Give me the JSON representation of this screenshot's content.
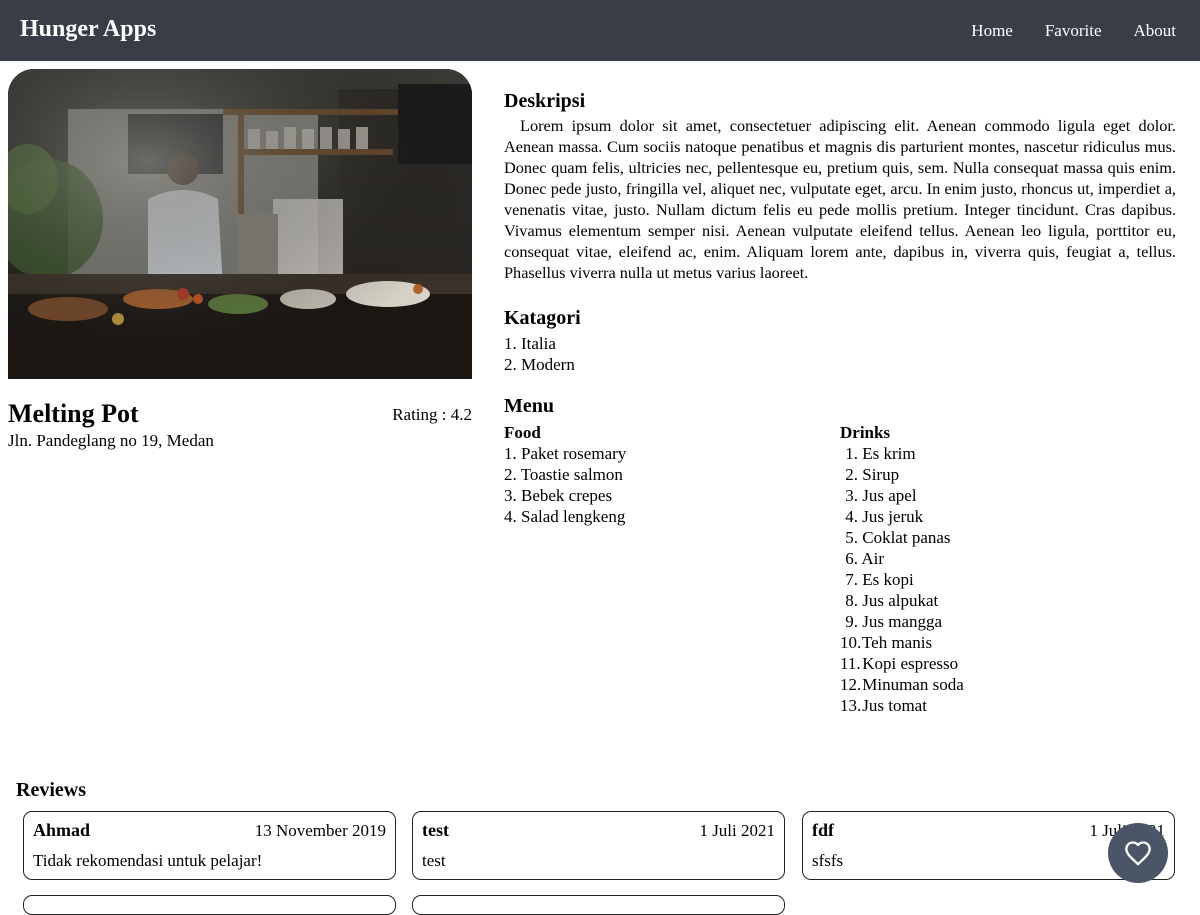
{
  "app": {
    "title": "Hunger Apps"
  },
  "nav": {
    "items": [
      "Home",
      "Favorite",
      "About"
    ]
  },
  "restaurant": {
    "name": "Melting Pot",
    "rating_label": "Rating : 4.2",
    "rating": 4.2,
    "address": "Jln. Pandeglang no 19, Medan",
    "image_alt": "Melting Pot"
  },
  "sections": {
    "description_title": "Deskripsi",
    "description": "Lorem ipsum dolor sit amet, consectetuer adipiscing elit. Aenean commodo ligula eget dolor. Aenean massa. Cum sociis natoque penatibus et magnis dis parturient montes, nascetur ridiculus mus. Donec quam felis, ultricies nec, pellentesque eu, pretium quis, sem. Nulla consequat massa quis enim. Donec pede justo, fringilla vel, aliquet nec, vulputate eget, arcu. In enim justo, rhoncus ut, imperdiet a, venenatis vitae, justo. Nullam dictum felis eu pede mollis pretium. Integer tincidunt. Cras dapibus. Vivamus elementum semper nisi. Aenean vulputate eleifend tellus. Aenean leo ligula, porttitor eu, consequat vitae, eleifend ac, enim. Aliquam lorem ante, dapibus in, viverra quis, feugiat a, tellus. Phasellus viverra nulla ut metus varius laoreet.",
    "category_title": "Katagori",
    "categories": [
      "1. Italia",
      "2. Modern"
    ],
    "menu_title": "Menu",
    "food_title": "Food",
    "foods": [
      "1. Paket rosemary",
      "2. Toastie salmon",
      "3. Bebek crepes",
      "4. Salad lengkeng"
    ],
    "drinks_title": "Drinks",
    "drinks": [
      {
        "n": "1.",
        "name": "Es krim"
      },
      {
        "n": "2.",
        "name": "Sirup"
      },
      {
        "n": "3.",
        "name": "Jus apel"
      },
      {
        "n": "4.",
        "name": "Jus jeruk"
      },
      {
        "n": "5.",
        "name": "Coklat panas"
      },
      {
        "n": "6.",
        "name": "Air"
      },
      {
        "n": "7.",
        "name": "Es kopi"
      },
      {
        "n": "8.",
        "name": "Jus alpukat"
      },
      {
        "n": "9.",
        "name": "Jus mangga"
      },
      {
        "n": "10.",
        "name": "Teh manis"
      },
      {
        "n": "11.",
        "name": "Kopi espresso"
      },
      {
        "n": "12.",
        "name": "Minuman soda"
      },
      {
        "n": "13.",
        "name": "Jus tomat"
      }
    ]
  },
  "reviews": {
    "title": "Reviews",
    "items": [
      {
        "name": "Ahmad",
        "date": "13 November 2019",
        "text": "Tidak rekomendasi untuk pelajar!"
      },
      {
        "name": "test",
        "date": "1 Juli 2021",
        "text": "test"
      },
      {
        "name": "fdf",
        "date": "1 Juli 2021",
        "text": "sfsfs"
      }
    ]
  },
  "favorite_button": {
    "icon": "heart-outline-icon",
    "color": "#4a5567"
  },
  "colors": {
    "header_bg": "#383d48"
  }
}
